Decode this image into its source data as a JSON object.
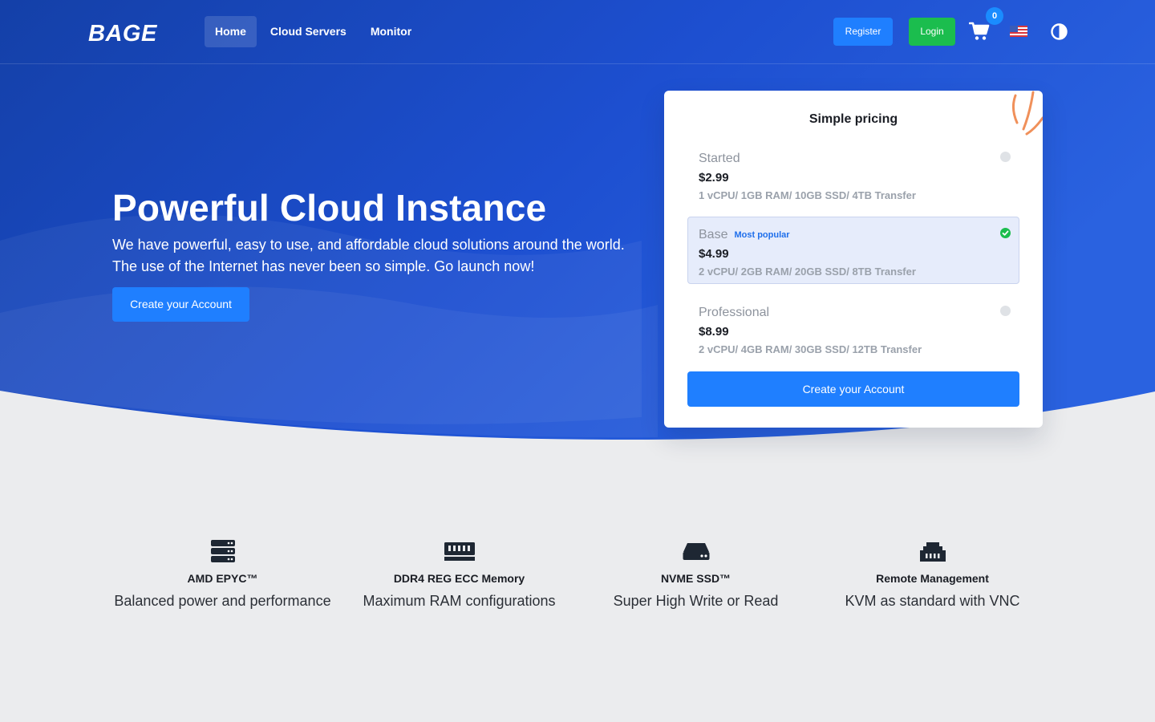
{
  "brand": {
    "logo_text": "BAGE"
  },
  "nav": {
    "items": [
      {
        "label": "Home",
        "active": true
      },
      {
        "label": "Cloud Servers",
        "active": false
      },
      {
        "label": "Monitor",
        "active": false
      }
    ]
  },
  "header_actions": {
    "register_label": "Register",
    "login_label": "Login",
    "cart_count": "0",
    "cart_icon": "shopping-cart-icon",
    "language_icon": "us-flag-icon",
    "theme_icon": "contrast-icon"
  },
  "hero": {
    "title": "Powerful Cloud Instance",
    "subtitle_line1": "We have powerful, easy to use, and affordable cloud solutions around the world.",
    "subtitle_line2": "The use of the Internet has never been so simple. Go launch now!",
    "cta_label": "Create your Account"
  },
  "pricing": {
    "title": "Simple pricing",
    "plans": [
      {
        "name": "Started",
        "badge": "",
        "price": "$2.99",
        "specs": "1 vCPU/ 1GB RAM/ 10GB SSD/ 4TB Transfer",
        "selected": false
      },
      {
        "name": "Base",
        "badge": "Most popular",
        "price": "$4.99",
        "specs": "2 vCPU/ 2GB RAM/ 20GB SSD/ 8TB Transfer",
        "selected": true
      },
      {
        "name": "Professional",
        "badge": "",
        "price": "$8.99",
        "specs": "2 vCPU/ 4GB RAM/ 30GB SSD/ 12TB Transfer",
        "selected": false
      }
    ],
    "cta_label": "Create your Account"
  },
  "features": [
    {
      "icon": "server-icon",
      "title": "AMD EPYC™",
      "description": "Balanced power and performance"
    },
    {
      "icon": "memory-icon",
      "title": "DDR4 REG ECC Memory",
      "description": "Maximum RAM configurations"
    },
    {
      "icon": "hard-drive-icon",
      "title": "NVME SSD™",
      "description": "Super High Write or Read"
    },
    {
      "icon": "ethernet-icon",
      "title": "Remote Management",
      "description": "KVM as standard with VNC"
    }
  ],
  "colors": {
    "hero_dark": "#1440a8",
    "hero_light": "#2a62e0",
    "primary": "#1f7fff",
    "success": "#1bbd4e",
    "page_bg": "#ebecee",
    "accent_orange": "#f0905a"
  }
}
